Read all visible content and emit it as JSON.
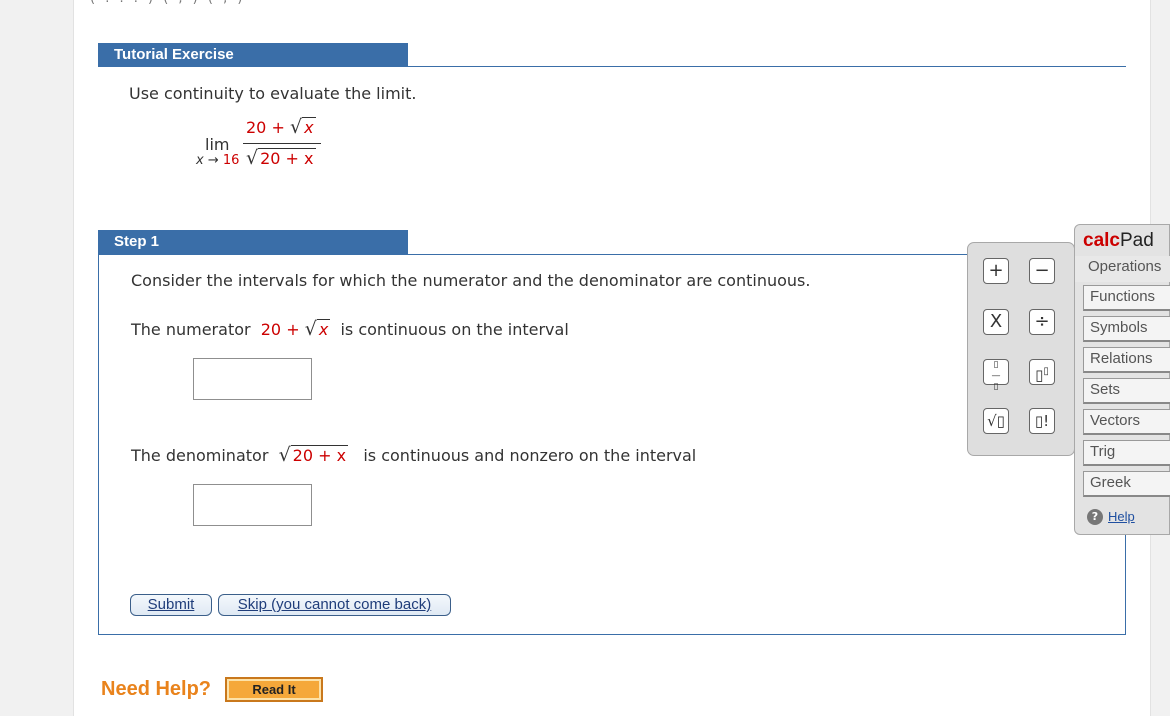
{
  "top_fragment": "( . . . ) ( , ) ( , )",
  "tutorial": {
    "header": "Tutorial Exercise",
    "prompt": "Use continuity to evaluate the limit.",
    "limit": {
      "lim": "lim",
      "sub_var": "x",
      "sub_arrow": "→",
      "sub_value": "16",
      "num_const": "20 +",
      "num_radicand": "x",
      "den_radicand": "20 + x"
    }
  },
  "step": {
    "header": "Step 1",
    "intro": "Consider the intervals for which the numerator and the denominator are continuous.",
    "numerator_prefix": "The numerator",
    "numerator_const": "20 +",
    "numerator_radicand": "x",
    "numerator_suffix": "is continuous on the interval",
    "numerator_answer": "",
    "denominator_prefix": "The denominator",
    "denominator_radicand": "20 + x",
    "denominator_suffix": "is continuous and nonzero on the interval",
    "denominator_answer": "",
    "submit_label": "Submit",
    "skip_label": "Skip (you cannot come back)"
  },
  "calcpad": {
    "title_red": "calc",
    "title_dark": "Pad",
    "keys": [
      "+",
      "−",
      "X",
      "÷",
      "▯/▯",
      "▯▯",
      "√▯",
      "▯!"
    ],
    "tabs": [
      "Operations",
      "Functions",
      "Symbols",
      "Relations",
      "Sets",
      "Vectors",
      "Trig",
      "Greek"
    ],
    "help_icon": "?",
    "help_label": "Help"
  },
  "help": {
    "need_help": "Need Help?",
    "read_it": "Read It"
  },
  "colors": {
    "section_bar": "#3a6ea8",
    "math_red": "#c00000",
    "need_help_orange": "#e9831c",
    "read_it_bg": "#f5a83a"
  }
}
